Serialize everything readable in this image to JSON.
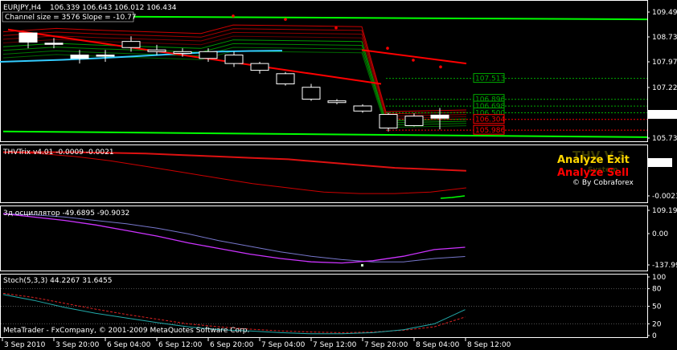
{
  "colors": {
    "background": "#000000",
    "frame": "#ffffff",
    "bull_candle": "#ffffff",
    "trend_red": "#ff0000",
    "ma_green": "#00ff00",
    "ma_cyan": "#33ccff",
    "level_green": "#00aa00",
    "level_red": "#ff0000",
    "thv_yellow": "#ffd700",
    "thv_red": "#ff0000",
    "osc_violet": "#cc33ff",
    "osc_slate": "#7777cc",
    "stoch_main": "#22aaaa",
    "stoch_signal": "#dd2222"
  },
  "main_panel": {
    "title": "EURJPY,H4",
    "ohlc": "106.339 106.643 106.012 106.434",
    "channel_text": "Channel size = 3576 Slope = -10.77",
    "price_labels": [
      "109.490",
      "108.730",
      "107.970",
      "107.220",
      "106.434",
      "105.730"
    ],
    "current_price": "106.434",
    "right_levels": [
      {
        "text": "107.513",
        "color": "#00aa00"
      },
      {
        "text": "106.896",
        "color": "#00aa00"
      },
      {
        "text": "106.698",
        "color": "#00aa00"
      },
      {
        "text": "106.500",
        "color": "#00aa00"
      },
      {
        "text": "106.304",
        "color": "#ff0000"
      },
      {
        "text": "105.986",
        "color": "#ff0000"
      }
    ]
  },
  "thv_panel": {
    "title": "THVTrix v4.01 -0.0009 -0.0021",
    "labels": [
      "0.000",
      "-0.0023"
    ],
    "current": "0.000",
    "watermark": "THV V.3",
    "watermark_sub": "System",
    "analyze_exit": "Analyze Exit",
    "analyze_sell": "Analyze Sell",
    "credit": "© By Cobraforex"
  },
  "osc_panel": {
    "title": "3д осциллятор -49.6895 -90.9032",
    "labels": [
      "109.191",
      "0.00",
      "-137.990"
    ]
  },
  "stoch_panel": {
    "title": "Stoch(5,3,3) 44.2267 31.6455",
    "labels": [
      "100",
      "80",
      "50",
      "20",
      "0"
    ],
    "copyright": "MetaTrader - FxCompany, © 2001-2009 MetaQuotes Software Corp."
  },
  "time_axis": [
    "3 Sep 2010",
    "3 Sep 20:00",
    "6 Sep 04:00",
    "6 Sep 12:00",
    "6 Sep 20:00",
    "7 Sep 04:00",
    "7 Sep 12:00",
    "7 Sep 20:00",
    "8 Sep 04:00",
    "8 Sep 12:00"
  ],
  "chart_data": [
    {
      "type": "candlestick",
      "title": "EURJPY,H4",
      "ylim": [
        105.73,
        109.49
      ],
      "candles": [
        {
          "x": 0,
          "open": 108.58,
          "high": 108.85,
          "low": 108.4,
          "close": 108.85
        },
        {
          "x": 1,
          "open": 108.55,
          "high": 108.7,
          "low": 108.4,
          "close": 108.55
        },
        {
          "x": 2,
          "open": 108.1,
          "high": 108.35,
          "low": 107.95,
          "close": 108.2
        },
        {
          "x": 3,
          "open": 108.2,
          "high": 108.35,
          "low": 108.0,
          "close": 108.2
        },
        {
          "x": 4,
          "open": 108.6,
          "high": 108.75,
          "low": 108.3,
          "close": 108.42
        },
        {
          "x": 5,
          "open": 108.35,
          "high": 108.5,
          "low": 108.2,
          "close": 108.3
        },
        {
          "x": 6,
          "open": 108.3,
          "high": 108.4,
          "low": 108.15,
          "close": 108.25
        },
        {
          "x": 7,
          "open": 108.3,
          "high": 108.4,
          "low": 108.0,
          "close": 108.1
        },
        {
          "x": 8,
          "open": 108.2,
          "high": 108.3,
          "low": 107.85,
          "close": 107.95
        },
        {
          "x": 9,
          "open": 107.95,
          "high": 108.0,
          "low": 107.65,
          "close": 107.75
        },
        {
          "x": 10,
          "open": 107.65,
          "high": 107.7,
          "low": 107.3,
          "close": 107.35
        },
        {
          "x": 11,
          "open": 107.25,
          "high": 107.35,
          "low": 106.85,
          "close": 106.9
        },
        {
          "x": 12,
          "open": 106.85,
          "high": 106.9,
          "low": 106.75,
          "close": 106.8
        },
        {
          "x": 13,
          "open": 106.7,
          "high": 106.75,
          "low": 106.5,
          "close": 106.55
        },
        {
          "x": 14,
          "open": 106.45,
          "high": 106.5,
          "low": 105.95,
          "close": 106.05
        },
        {
          "x": 15,
          "open": 106.4,
          "high": 106.48,
          "low": 106.1,
          "close": 106.12
        },
        {
          "x": 16,
          "open": 106.34,
          "high": 106.64,
          "low": 106.01,
          "close": 106.43
        }
      ],
      "series": [
        {
          "values": [
            108.0,
            108.03,
            108.06,
            108.1,
            108.15,
            108.2,
            108.25,
            108.3,
            108.32,
            108.33
          ]
        },
        {
          "values": [
            108.95,
            108.85,
            108.75,
            108.65,
            108.55,
            108.45,
            108.35,
            108.25,
            108.15,
            108.05,
            107.95,
            107.85,
            107.75,
            107.65,
            107.55,
            107.45,
            107.35
          ]
        }
      ],
      "levels": [
        107.513,
        106.896,
        106.698,
        106.5,
        106.304,
        105.986
      ]
    },
    {
      "type": "line",
      "title": "THVTrix v4.01",
      "ylim": [
        -0.003,
        0.0006
      ],
      "series": [
        {
          "values": [
            0.0004,
            0.0004,
            0.0004,
            0.00035,
            0.0003,
            0.0002,
            0.0001,
            0.0,
            -0.0001,
            -0.0003,
            -0.0005,
            -0.0007,
            -0.0008,
            -0.0009
          ]
        },
        {
          "values": [
            0.0004,
            0.0003,
            0.0001,
            -0.0002,
            -0.0006,
            -0.001,
            -0.0014,
            -0.0018,
            -0.0021,
            -0.0024,
            -0.0025,
            -0.0025,
            -0.0024,
            -0.0021
          ]
        }
      ]
    },
    {
      "type": "line",
      "title": "3д осциллятор",
      "ylim": [
        -150,
        115
      ],
      "series": [
        {
          "values": [
            100,
            85,
            70,
            50,
            25,
            0,
            -30,
            -55,
            -80,
            -100,
            -115,
            -120,
            -110,
            -90,
            -60,
            -49.69
          ]
        },
        {
          "values": [
            100,
            95,
            85,
            70,
            55,
            35,
            10,
            -20,
            -45,
            -70,
            -90,
            -105,
            -115,
            -115,
            -100,
            -90.9
          ]
        }
      ]
    },
    {
      "type": "line",
      "title": "Stoch(5,3,3)",
      "ylim": [
        0,
        100
      ],
      "series": [
        {
          "values": [
            70,
            60,
            48,
            38,
            30,
            22,
            15,
            10,
            8,
            5,
            3,
            3,
            5,
            10,
            20,
            44.23
          ]
        },
        {
          "values": [
            72,
            65,
            55,
            45,
            36,
            28,
            20,
            15,
            11,
            8,
            6,
            5,
            6,
            9,
            15,
            31.65
          ]
        }
      ],
      "levels": [
        80,
        50,
        20
      ]
    }
  ]
}
